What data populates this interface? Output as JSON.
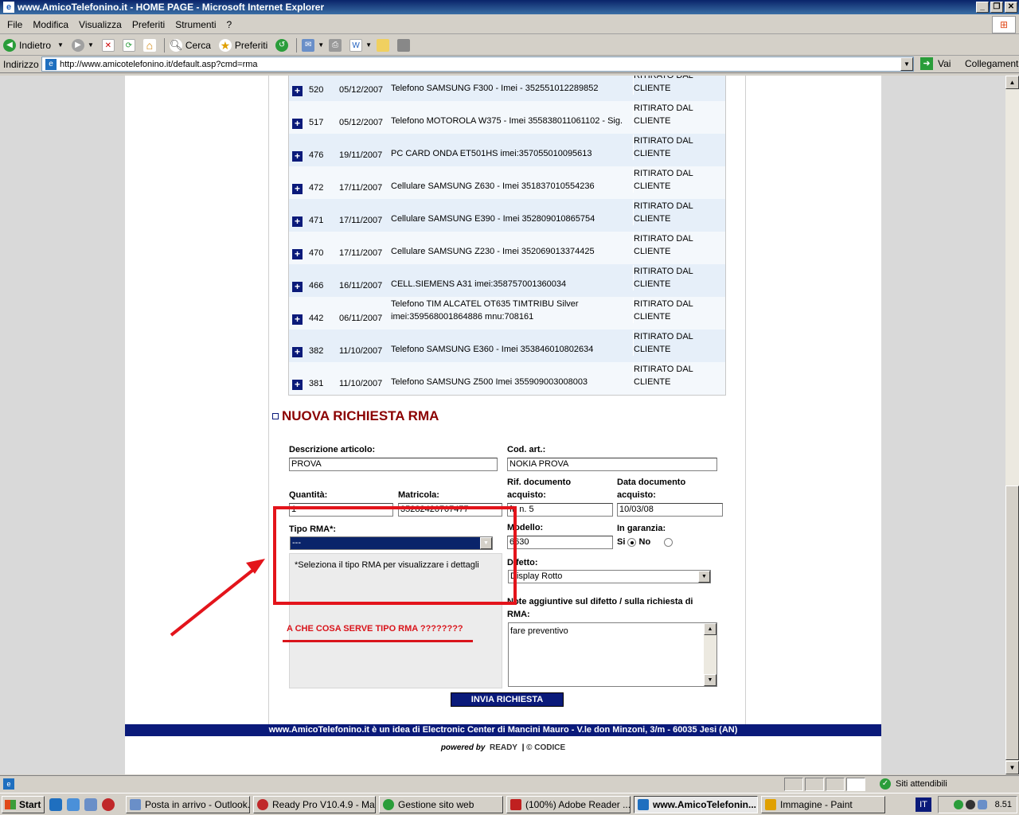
{
  "window": {
    "title": "www.AmicoTelefonino.it - HOME PAGE - Microsoft Internet Explorer"
  },
  "menu": [
    "File",
    "Modifica",
    "Visualizza",
    "Preferiti",
    "Strumenti",
    "?"
  ],
  "toolbar": {
    "back": "Indietro",
    "search": "Cerca",
    "favorites": "Preferiti"
  },
  "address": {
    "label": "Indirizzo",
    "url": "http://www.amicotelefonino.it/default.asp?cmd=rma",
    "go": "Vai",
    "links": "Collegamenti"
  },
  "rma_rows": [
    {
      "num": "520",
      "date": "05/12/2007",
      "desc": "Telefono SAMSUNG F300 - Imei - 352551012289852",
      "status": "CLIENTE",
      "status_top": "RITIRATO DAL"
    },
    {
      "num": "517",
      "date": "05/12/2007",
      "desc": "Telefono MOTOROLA W375 - Imei 355838011061102 - Sig.",
      "status": "CLIENTE",
      "status_top": "RITIRATO DAL"
    },
    {
      "num": "476",
      "date": "19/11/2007",
      "desc": "PC CARD ONDA ET501HS imei:357055010095613",
      "status": "CLIENTE",
      "status_top": "RITIRATO DAL"
    },
    {
      "num": "472",
      "date": "17/11/2007",
      "desc": "Cellulare SAMSUNG Z630 - Imei 351837010554236",
      "status": "CLIENTE",
      "status_top": "RITIRATO DAL"
    },
    {
      "num": "471",
      "date": "17/11/2007",
      "desc": "Cellulare SAMSUNG E390 - Imei 352809010865754",
      "status": "CLIENTE",
      "status_top": "RITIRATO DAL"
    },
    {
      "num": "470",
      "date": "17/11/2007",
      "desc": "Cellulare SAMSUNG Z230 - Imei 352069013374425",
      "status": "CLIENTE",
      "status_top": "RITIRATO DAL"
    },
    {
      "num": "466",
      "date": "16/11/2007",
      "desc": "CELL.SIEMENS A31 imei:358757001360034",
      "status": "CLIENTE",
      "status_top": "RITIRATO DAL"
    },
    {
      "num": "442",
      "date": "06/11/2007",
      "desc": "Telefono TIM ALCATEL OT635 TIMTRIBU Silver imei:359568001864886 mnu:708161",
      "status": "CLIENTE",
      "status_top": "RITIRATO DAL"
    },
    {
      "num": "382",
      "date": "11/10/2007",
      "desc": "Telefono SAMSUNG E360 - Imei 353846010802634",
      "status": "CLIENTE",
      "status_top": "RITIRATO DAL"
    },
    {
      "num": "381",
      "date": "11/10/2007",
      "desc": "Telefono SAMSUNG Z500 Imei 355909003008003",
      "status": "CLIENTE",
      "status_top": "RITIRATO DAL"
    }
  ],
  "form": {
    "title": "NUOVA RICHIESTA RMA",
    "desc_label": "Descrizione articolo:",
    "desc_value": "PROVA",
    "cod_label": "Cod. art.:",
    "cod_value": "NOKIA PROVA",
    "qty_label": "Quantità:",
    "qty_value": "1",
    "serial_label": "Matricola:",
    "serial_value": "35282420707477",
    "rif_label": "Rif. documento acquisto:",
    "rif_value": "ft. n. 5",
    "data_label": "Data documento acquisto:",
    "data_value": "10/03/08",
    "tipo_label": "Tipo RMA*:",
    "tipo_value": "---",
    "modello_label": "Modello:",
    "modello_value": "6630",
    "garanzia_label": "In garanzia:",
    "si": "Si",
    "no": "No",
    "hint": "*Seleziona il tipo RMA per visualizzare i dettagli",
    "difetto_label": "Difetto:",
    "difetto_value": "Display Rotto",
    "note_label": "Note aggiuntive sul difetto / sulla richiesta di RMA:",
    "note_value": "fare preventivo",
    "submit": "INVIA RICHIESTA"
  },
  "annotation": {
    "text": "A CHE COSA SERVE TIPO RMA ????????",
    "color": "#e3141b"
  },
  "footer": {
    "text": "www.AmicoTelefonino.it è un idea di Electronic Center di Mancini Mauro - V.le don Minzoni, 3/m - 60035 Jesi (AN)",
    "powered": "powered by",
    "brand1": "READY",
    "brand2": "© CODICE"
  },
  "status": {
    "zone": "Siti attendibili"
  },
  "taskbar": {
    "start": "Start",
    "tasks": [
      "Posta in arrivo - Outlook...",
      "Ready Pro V10.4.9 - Ma...",
      "Gestione sito web",
      "(100%) Adobe Reader ...",
      "www.AmicoTelefonin...",
      "Immagine - Paint"
    ],
    "lang": "IT",
    "time": "8.51"
  }
}
